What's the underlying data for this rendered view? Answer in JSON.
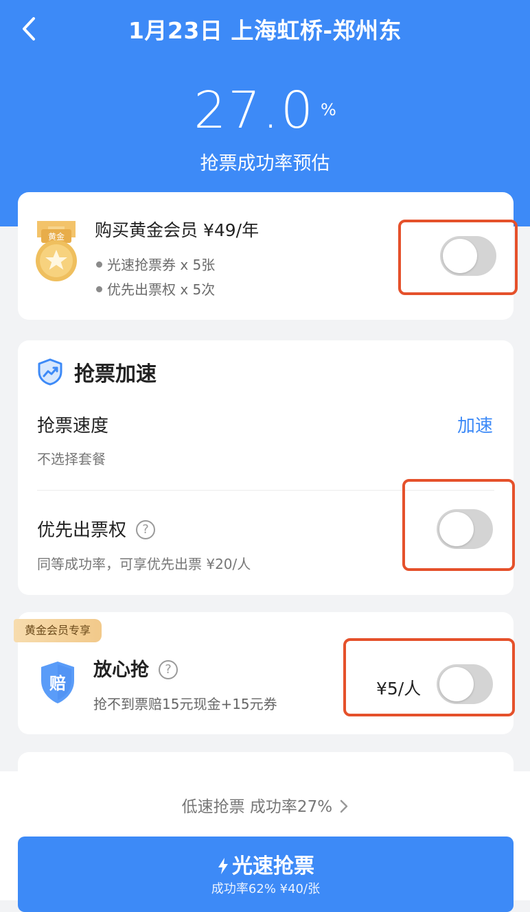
{
  "header": {
    "title": "1月23日 上海虹桥-郑州东",
    "rate_value": "27.0",
    "rate_unit": "%",
    "rate_label": "抢票成功率预估"
  },
  "membership": {
    "medal_text": "黄金",
    "title": "购买黄金会员 ¥49/年",
    "benefits": [
      "光速抢票券 x 5张",
      "优先出票权 x 5次"
    ],
    "toggle_on": false
  },
  "acceleration": {
    "title": "抢票加速",
    "speed_label": "抢票速度",
    "speed_sub": "不选择套餐",
    "speed_action": "加速",
    "priority_label": "优先出票权",
    "priority_help": "?",
    "priority_sub": "同等成功率，可享优先出票 ¥20/人",
    "priority_toggle_on": false
  },
  "insurance": {
    "badge": "黄金会员专享",
    "shield_text": "赔",
    "title": "放心抢",
    "help": "?",
    "sub": "抢不到票赔15元现金+15元券",
    "price": "¥5/人",
    "toggle_on": false
  },
  "footer": {
    "low_speed_link": "低速抢票 成功率27%",
    "cta_title": "光速抢票",
    "cta_sub": "成功率62% ¥40/张"
  },
  "colors": {
    "primary": "#3d8af7",
    "highlight": "#e5512b",
    "toggle_off": "#d4d4d4",
    "gold": "#e8b450"
  }
}
